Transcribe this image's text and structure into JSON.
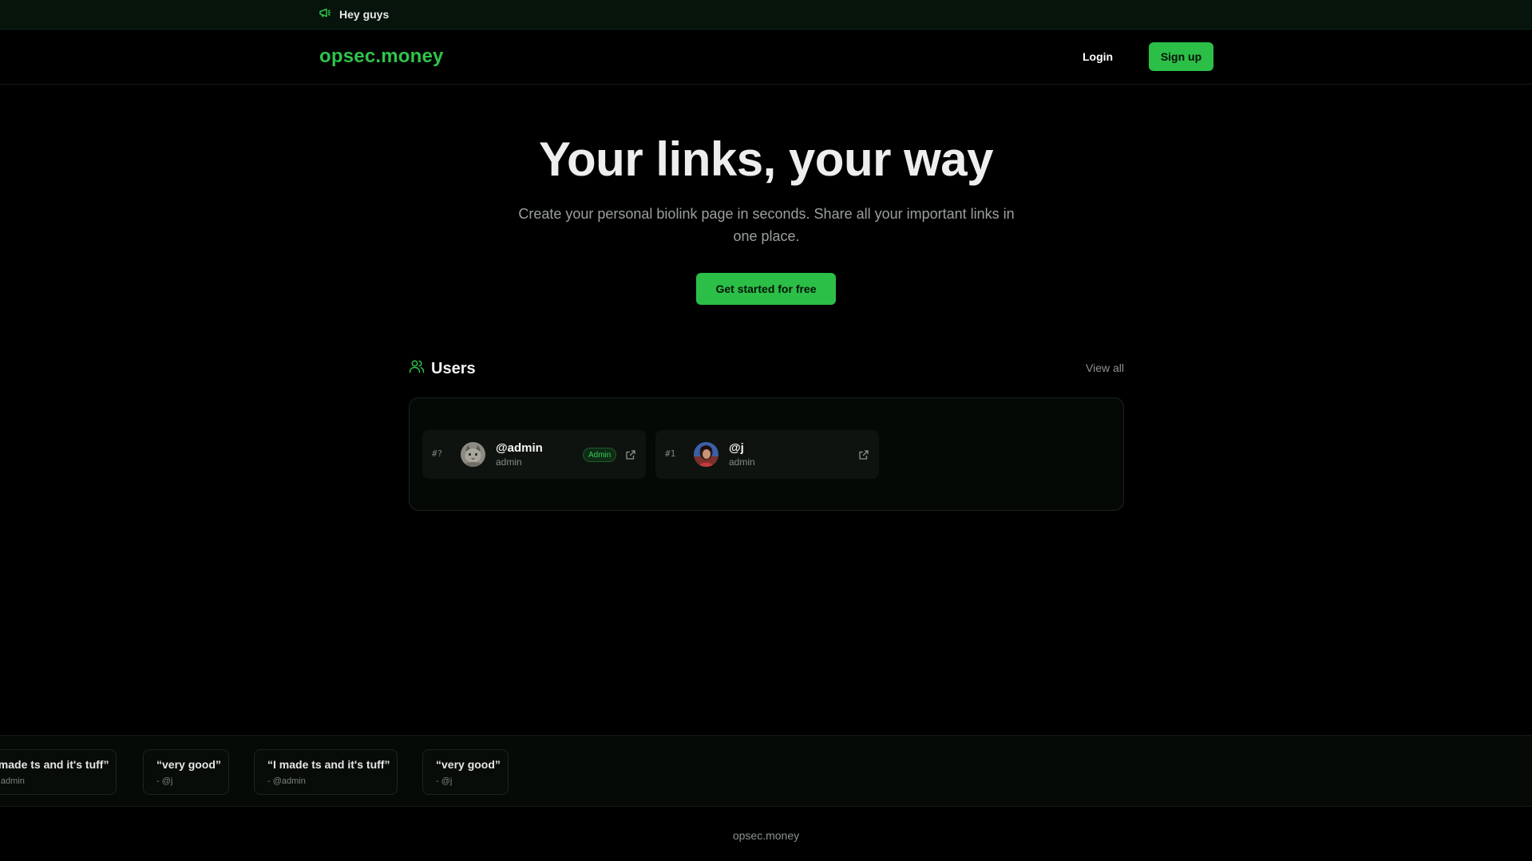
{
  "announcement": {
    "text": "Hey guys",
    "icon": "megaphone-icon"
  },
  "header": {
    "logo": "opsec.money",
    "login_label": "Login",
    "signup_label": "Sign up"
  },
  "hero": {
    "title": "Your links, your way",
    "subtitle": "Create your personal biolink page in seconds. Share all your important links in one place.",
    "cta_label": "Get started for free"
  },
  "users": {
    "title": "Users",
    "view_all_label": "View all",
    "items": [
      {
        "rank": "#?",
        "username": "@admin",
        "role": "admin",
        "badge": "Admin"
      },
      {
        "rank": "#1",
        "username": "@j",
        "role": "admin"
      }
    ]
  },
  "testimonials": [
    {
      "quote": "“I made ts and it's tuff”",
      "author": "- @admin"
    },
    {
      "quote": "“very good”",
      "author": "- @j"
    },
    {
      "quote": "“I made ts and it's tuff”",
      "author": "- @admin"
    },
    {
      "quote": "“very good”",
      "author": "- @j"
    }
  ],
  "footer": {
    "brand": "opsec.money"
  },
  "colors": {
    "accent": "#2bbf47",
    "background": "#000000",
    "announce_bg": "#06140b"
  }
}
